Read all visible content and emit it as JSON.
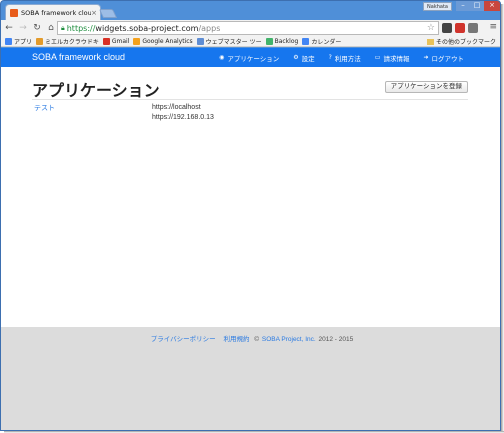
{
  "browser": {
    "tab_title": "SOBA framework cloud",
    "user_badge": "Nakhata",
    "address": {
      "scheme": "https://",
      "host": "widgets.soba-project.com",
      "path": "/apps"
    },
    "bookmarks": [
      {
        "label": "アプリ",
        "icon": "apps-grid-icon",
        "color": "#4285f4"
      },
      {
        "label": "ミエルカクラウドキ",
        "icon": "bookmark-icon",
        "color": "#e39b2b"
      },
      {
        "label": "Gmail",
        "icon": "gmail-icon",
        "color": "#d93025"
      },
      {
        "label": "Google Analytics",
        "icon": "analytics-icon",
        "color": "#f4a11d"
      },
      {
        "label": "ウェブマスター ツー",
        "icon": "webmaster-icon",
        "color": "#5f8dd3"
      },
      {
        "label": "Backlog",
        "icon": "backlog-icon",
        "color": "#42b36b"
      },
      {
        "label": "カレンダー",
        "icon": "calendar-icon",
        "color": "#4285f4"
      }
    ],
    "other_bookmarks": "その他のブックマーク"
  },
  "app": {
    "brand": "SOBA framework cloud",
    "nav": [
      {
        "label": "アプリケーション",
        "icon": "grid-icon",
        "glyph": "◉"
      },
      {
        "label": "設定",
        "icon": "gear-icon",
        "glyph": "⚙"
      },
      {
        "label": "利用方法",
        "icon": "question-icon",
        "glyph": "?"
      },
      {
        "label": "請求情報",
        "icon": "credit-card-icon",
        "glyph": "▭"
      },
      {
        "label": "ログアウト",
        "icon": "logout-icon",
        "glyph": "➜"
      }
    ]
  },
  "main": {
    "title": "アプリケーション",
    "register_button": "アプリケーションを登録",
    "apps": [
      {
        "name": "テスト",
        "urls": [
          "https://localhost",
          "https://192.168.0.13"
        ]
      }
    ]
  },
  "footer": {
    "privacy": "プライバシーポリシー",
    "terms": "利用規約",
    "copyright_prefix": "©",
    "company": "SOBA Project, Inc.",
    "years": "2012 - 2015"
  }
}
